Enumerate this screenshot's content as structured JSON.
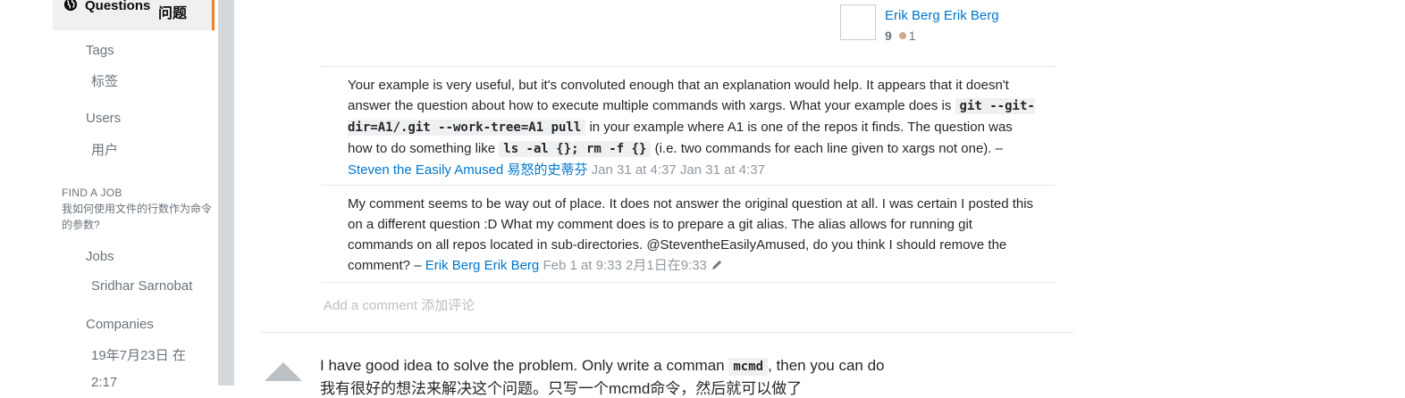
{
  "sidebar": {
    "active": {
      "label": "Questions",
      "label_cn": "问题"
    },
    "tags": {
      "label": "Tags",
      "label_cn": "标签"
    },
    "users": {
      "label": "Users",
      "label_cn": "用户"
    },
    "find_job": {
      "heading": "FIND A JOB",
      "heading_cn": "我如何使用文件的行数作为命令的参数?"
    },
    "jobs": {
      "label": "Jobs",
      "sub": "Sridhar Sarnobat"
    },
    "companies": {
      "label": "Companies",
      "sub": "19年7月23日 在",
      "sub2": "2:17"
    }
  },
  "user_card": {
    "name1": "Erik Berg",
    "name2": "Erik Berg",
    "reputation": "9",
    "bronze_badges": "1"
  },
  "comments": [
    {
      "text1": "Your example is very useful, but it's convoluted enough that an explanation would help. It appears that it doesn't answer the question about how to execute multiple commands with xargs. What your example does is ",
      "code1": "git --git-dir=A1/.git --work-tree=A1 pull",
      "text2": " in your example where A1 is one of the repos it finds. The question was how to do something like ",
      "code2": "ls -al {}; rm -f {}",
      "text3": " (i.e. two commands for each line given to xargs not one). – ",
      "user": "Steven the Easily Amused",
      "user_cn": "易怒的史蒂芬",
      "time": "Jan 31 at 4:37",
      "time2": "Jan 31 at 4:37"
    },
    {
      "text1": "My comment seems to be way out of place. It does not answer the original question at all. I was certain I posted this on a different question :D What my comment does is to prepare a git alias. The alias allows for running git commands on all repos located in sub-directories. @SteventheEasilyAmused, do you think I should remove the comment? – ",
      "user": "Erik Berg",
      "user2": "Erik Berg",
      "time": "Feb 1 at 9:33",
      "time_cn": "2月1日在9:33"
    }
  ],
  "add_comment": {
    "label": "Add a comment",
    "label_cn": "添加评论"
  },
  "answer": {
    "text1": "I have good idea to solve the problem. Only write a comman ",
    "code": "mcmd",
    "text2": ", then you can do",
    "text_cn": "我有很好的想法来解决这个问题。只写一个mcmd命令，然后就可以做了"
  }
}
